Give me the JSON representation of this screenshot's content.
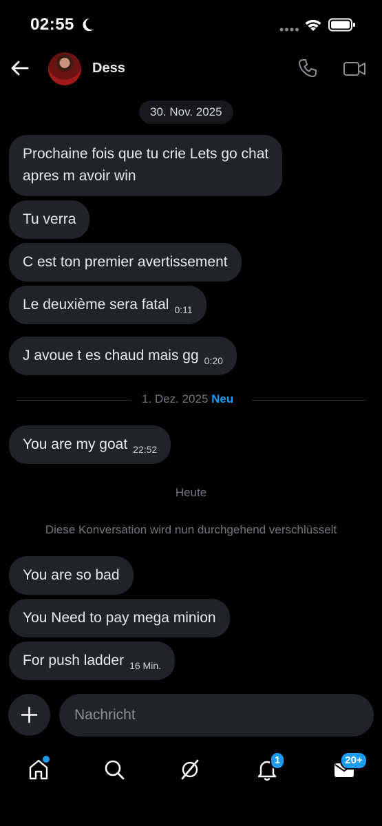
{
  "status_bar": {
    "time": "02:55"
  },
  "header": {
    "contact_name": "Dess"
  },
  "conversation": {
    "date_1": "30. Nov. 2025",
    "messages_1": [
      {
        "text_line1": "Prochaine fois que tu crie Lets go chat",
        "text_line2": "apres m avoir win"
      },
      {
        "text": "Tu verra"
      },
      {
        "text": "C est ton premier avertissement"
      },
      {
        "text": "Le deuxième sera fatal",
        "time": "0:11"
      },
      {
        "text": "J avoue t es chaud mais gg",
        "time": "0:20"
      }
    ],
    "divider": {
      "date": "1. Dez. 2025",
      "new_label": "Neu"
    },
    "messages_2": [
      {
        "text": "You are my goat",
        "time": "22:52"
      }
    ],
    "today_label": "Heute",
    "encryption_notice": "Diese Konversation wird nun durchgehend verschlüsselt",
    "messages_3": [
      {
        "text": "You are so bad"
      },
      {
        "text": "You Need to pay mega minion"
      },
      {
        "text": "For push ladder",
        "time": "16 Min."
      }
    ]
  },
  "composer": {
    "placeholder": "Nachricht"
  },
  "bottom_nav": {
    "notifications_badge": "1",
    "messages_badge": "20+",
    "accent_color": "#1d9bf0"
  }
}
